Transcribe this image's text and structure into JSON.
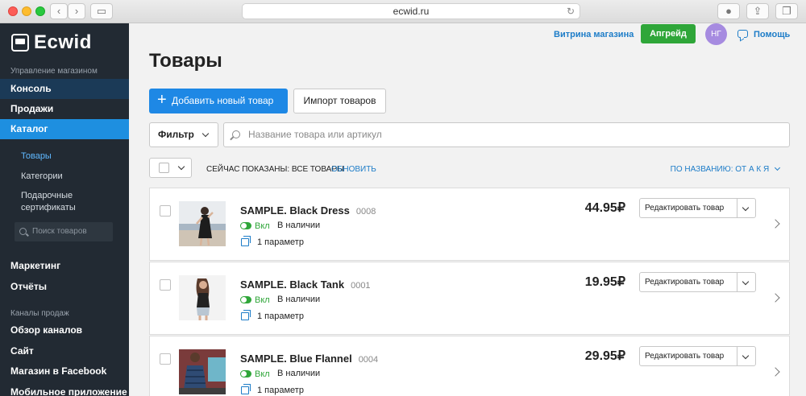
{
  "browser": {
    "address": "ecwid.ru"
  },
  "sidebar": {
    "logo": "Ecwid",
    "section_manage": "Управление магазином",
    "items": {
      "console": "Консоль",
      "sales": "Продажи",
      "catalog": "Каталог"
    },
    "catalog_sub": {
      "products": "Товары",
      "categories": "Категории",
      "gift_cards_line1": "Подарочные",
      "gift_cards_line2": "сертификаты"
    },
    "search_placeholder": "Поиск товаров",
    "items2": {
      "marketing": "Маркетинг",
      "reports": "Отчёты"
    },
    "section_channels": "Каналы продаж",
    "channels": {
      "overview": "Обзор каналов",
      "site": "Сайт",
      "facebook": "Магазин в Facebook",
      "mobile": "Мобильное приложение"
    }
  },
  "header": {
    "storefront": "Витрина магазина",
    "upgrade": "Апгрейд",
    "avatar": "НГ",
    "help": "Помощь"
  },
  "page": {
    "title": "Товары",
    "add_button": "Добавить новый товар",
    "import_button": "Импорт товаров",
    "filter_button": "Фильтр",
    "search_placeholder": "Название товара или артикул",
    "shown_text": "СЕЙЧАС ПОКАЗАНЫ: ВСЕ ТОВАРЫ",
    "refresh": "ОБНОВИТЬ",
    "sort": "ПО НАЗВАНИЮ: ОТ А К Я"
  },
  "products": [
    {
      "name": "SAMPLE. Black Dress",
      "sku": "0008",
      "enabled_label": "Вкл",
      "stock": "В наличии",
      "options": "1 параметр",
      "price": "44.95₽",
      "edit": "Редактировать товар"
    },
    {
      "name": "SAMPLE. Black Tank",
      "sku": "0001",
      "enabled_label": "Вкл",
      "stock": "В наличии",
      "options": "1 параметр",
      "price": "19.95₽",
      "edit": "Редактировать товар"
    },
    {
      "name": "SAMPLE. Blue Flannel",
      "sku": "0004",
      "enabled_label": "Вкл",
      "stock": "В наличии",
      "options": "1 параметр",
      "price": "29.95₽",
      "edit": "Редактировать товар"
    }
  ],
  "colors": {
    "sidebar_bg": "#222a33",
    "accent_blue": "#1e88e5",
    "green": "#2fa639",
    "link": "#1e7dc8"
  }
}
